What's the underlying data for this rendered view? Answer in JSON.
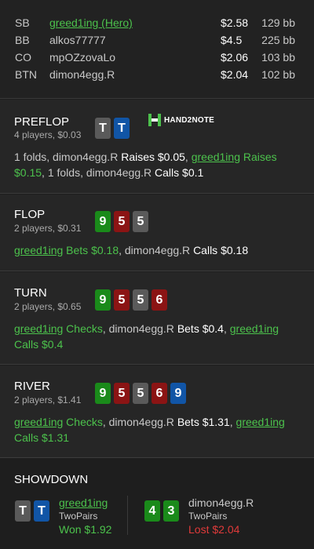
{
  "players": [
    {
      "pos": "SB",
      "name": "greed1ing (Hero)",
      "stack": "$2.58",
      "bb": "129 bb",
      "hero": true
    },
    {
      "pos": "BB",
      "name": "alkos77777",
      "stack": "$4.5",
      "bb": "225 bb",
      "hero": false
    },
    {
      "pos": "CO",
      "name": "mpOZzovaLo",
      "stack": "$2.06",
      "bb": "103 bb",
      "hero": false
    },
    {
      "pos": "BTN",
      "name": "dimon4egg.R",
      "stack": "$2.04",
      "bb": "102 bb",
      "hero": false
    }
  ],
  "logo": {
    "text": "HAND2NOTE",
    "icon": "h2n-logo-icon"
  },
  "preflop": {
    "title": "PREFLOP",
    "sub": "4 players, $0.03",
    "cards": [
      {
        "r": "T",
        "s": "spade"
      },
      {
        "r": "T",
        "s": "diamond"
      }
    ],
    "a": [
      "1 folds, dimon4egg.R ",
      "Raises $0.05",
      ", ",
      "greed1ing",
      " Raises $0.15",
      ", 1 folds, dimon4egg.R ",
      "Calls $0.1"
    ]
  },
  "flop": {
    "title": "FLOP",
    "sub": "2 players, $0.31",
    "cards": [
      {
        "r": "9",
        "s": "club"
      },
      {
        "r": "5",
        "s": "heart"
      },
      {
        "r": "5",
        "s": "spade"
      }
    ],
    "a": [
      "greed1ing",
      " Bets $0.18",
      ", dimon4egg.R ",
      "Calls $0.18"
    ]
  },
  "turn": {
    "title": "TURN",
    "sub": "2 players, $0.65",
    "cards": [
      {
        "r": "9",
        "s": "club"
      },
      {
        "r": "5",
        "s": "heart"
      },
      {
        "r": "5",
        "s": "spade"
      },
      {
        "r": "6",
        "s": "heart"
      }
    ],
    "a": [
      "greed1ing",
      " Checks",
      ", dimon4egg.R ",
      "Bets $0.4",
      ", ",
      "greed1ing",
      " Calls $0.4"
    ]
  },
  "river": {
    "title": "RIVER",
    "sub": "2 players, $1.41",
    "cards": [
      {
        "r": "9",
        "s": "club"
      },
      {
        "r": "5",
        "s": "heart"
      },
      {
        "r": "5",
        "s": "spade"
      },
      {
        "r": "6",
        "s": "heart"
      },
      {
        "r": "9",
        "s": "diamond"
      }
    ],
    "a": [
      "greed1ing",
      " Checks",
      ", dimon4egg.R ",
      "Bets $1.31",
      ", ",
      "greed1ing",
      " Calls $1.31"
    ]
  },
  "showdown": {
    "title": "SHOWDOWN",
    "hero": {
      "name": "greed1ing",
      "hand": "TwoPairs",
      "result": "Won $1.92",
      "cards": [
        {
          "r": "T",
          "s": "spade"
        },
        {
          "r": "T",
          "s": "diamond"
        }
      ]
    },
    "villain": {
      "name": "dimon4egg.R",
      "hand": "TwoPairs",
      "result": "Lost $2.04",
      "cards": [
        {
          "r": "4",
          "s": "club"
        },
        {
          "r": "3",
          "s": "club"
        }
      ]
    }
  },
  "colors": {
    "hero": "#4cc24c",
    "lost": "#e03a3a",
    "spade": "#5a5a5a",
    "heart": "#8b1414",
    "diamond": "#1155a6",
    "club": "#1a8a1a"
  }
}
